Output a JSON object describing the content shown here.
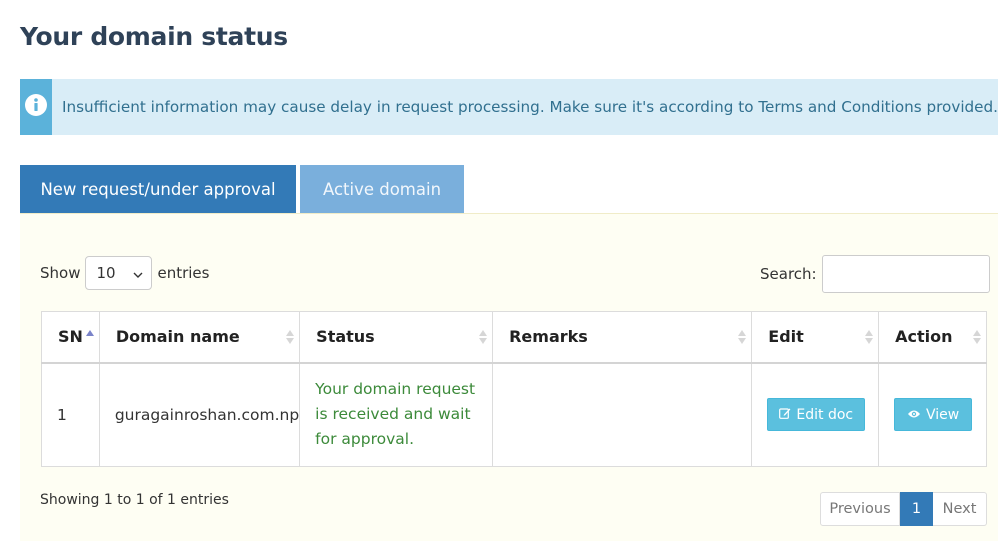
{
  "page": {
    "title": "Your domain status"
  },
  "alert": {
    "icon": "info-circle-icon",
    "text": "Insufficient information may cause delay in request processing. Make sure it's according to Terms and Conditions provided."
  },
  "tabs": [
    {
      "label": "New request/under approval",
      "active": true
    },
    {
      "label": "Active domain",
      "active": false
    }
  ],
  "length_control": {
    "prefix": "Show",
    "selected": "10",
    "suffix": "entries"
  },
  "search": {
    "label": "Search:",
    "value": ""
  },
  "table": {
    "columns": [
      "SN",
      "Domain name",
      "Status",
      "Remarks",
      "Edit",
      "Action"
    ],
    "rows": [
      {
        "sn": "1",
        "domain": "guragainroshan.com.np",
        "status": "Your domain request is received and wait for approval.",
        "remarks": "",
        "edit_label": "Edit doc",
        "action_label": "View"
      }
    ]
  },
  "footer": {
    "info": "Showing 1 to 1 of 1 entries",
    "pager": {
      "previous": "Previous",
      "current": "1",
      "next": "Next"
    }
  },
  "colors": {
    "primary": "#337ab7",
    "tab_inactive": "#7aafdc",
    "info_button": "#5bc0de",
    "alert_bg": "#d9edf7",
    "alert_text": "#31708f",
    "status_text": "#3c8a3a",
    "panel_bg": "#fefef3"
  }
}
